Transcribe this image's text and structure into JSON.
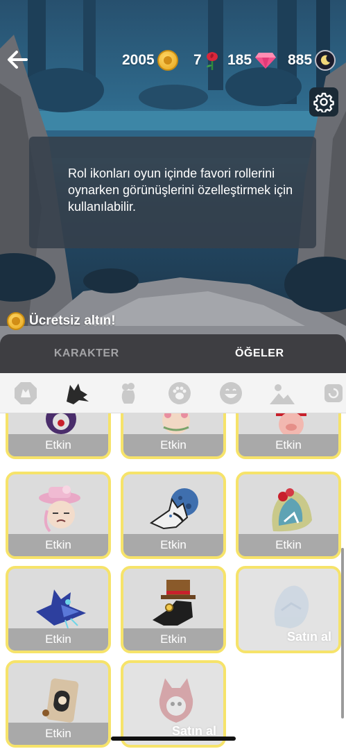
{
  "header": {
    "currencies": [
      {
        "name": "gold",
        "value": "2005",
        "icon": "gold-coin-icon"
      },
      {
        "name": "roses",
        "value": "7",
        "icon": "rose-icon"
      },
      {
        "name": "gems",
        "value": "185",
        "icon": "gem-icon"
      },
      {
        "name": "moon",
        "value": "885",
        "icon": "moon-coin-icon"
      }
    ]
  },
  "info": {
    "text": "Rol ikonları oyun içinde favori rollerini oynarken görünüşlerini özelleştirmek için kullanılabilir."
  },
  "free_gold": {
    "label": "Ücretsiz altın!"
  },
  "tabs": [
    {
      "label": "KARAKTER",
      "active": false
    },
    {
      "label": "ÖĞELER",
      "active": true
    }
  ],
  "categories": [
    {
      "icon": "badge-icon",
      "active": false
    },
    {
      "icon": "wolf-head-icon",
      "active": true
    },
    {
      "icon": "rose-bouquet-icon",
      "active": false
    },
    {
      "icon": "paw-icon",
      "active": false
    },
    {
      "icon": "emoji-icon",
      "active": false
    },
    {
      "icon": "landscape-icon",
      "active": false
    },
    {
      "icon": "more-icon",
      "active": false
    }
  ],
  "items": [
    {
      "label": "Etkin",
      "state": "active",
      "art": "dark-clown"
    },
    {
      "label": "Etkin",
      "state": "active",
      "art": "flower-girl"
    },
    {
      "label": "Etkin",
      "state": "active",
      "art": "pig-chef"
    },
    {
      "label": "Etkin",
      "state": "active",
      "art": "pink-hat-lady"
    },
    {
      "label": "Etkin",
      "state": "active",
      "art": "moon-wolf"
    },
    {
      "label": "Etkin",
      "state": "active",
      "art": "red-riding-hood-wolf"
    },
    {
      "label": "Etkin",
      "state": "active",
      "art": "blue-wolf"
    },
    {
      "label": "Etkin",
      "state": "active",
      "art": "top-hat-plague-wolf"
    },
    {
      "label": "Satın al",
      "state": "locked",
      "art": "ghost-wolf"
    },
    {
      "label": "Etkin",
      "state": "active",
      "art": "hooded-figure"
    },
    {
      "label": "Satın al",
      "state": "locked",
      "art": "skull-wolf"
    }
  ],
  "colors": {
    "card_border": "#f6e36a",
    "tab_panel": "#3e3e42",
    "info_box": "#35404b"
  }
}
